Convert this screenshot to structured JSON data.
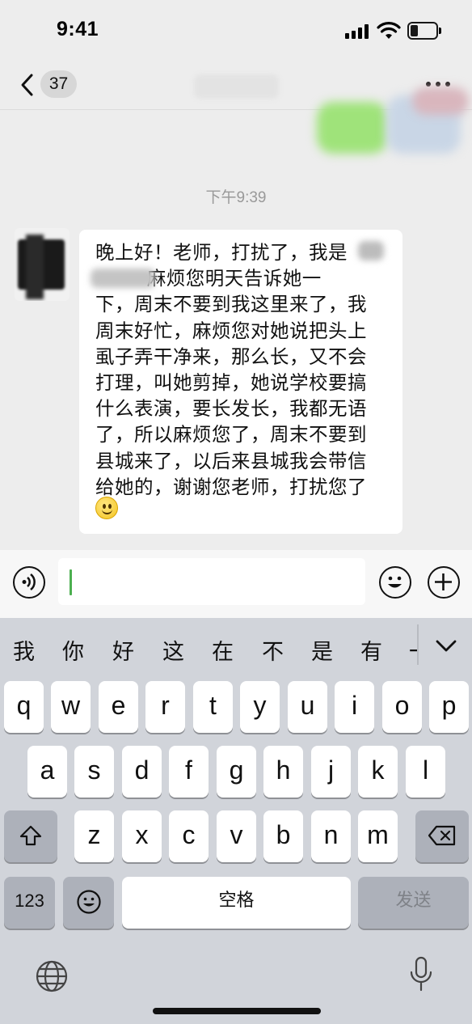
{
  "status_bar": {
    "time": "9:41"
  },
  "nav": {
    "unread_count": "37"
  },
  "chat": {
    "timestamp": "下午9:39",
    "message": {
      "lines": [
        "晚上好！老师，打扰了，我是",
        "        麻烦您明天告诉她一",
        "下，周末不要到我这里来了，我",
        "周末好忙，麻烦您对她说把头上",
        "虱子弄干净来，那么长，又不会",
        "打理，叫她剪掉，她说学校要搞",
        "什么表演，要长发长，我都无语",
        "了，所以麻烦您了，周末不要到",
        "县城来了，以后来县城我会带信",
        "给她的，谢谢您老师，打扰您了"
      ],
      "emoji": "smile-emoji"
    }
  },
  "input": {
    "value": ""
  },
  "keyboard": {
    "candidates": [
      "我",
      "你",
      "好",
      "这",
      "在",
      "不",
      "是",
      "有",
      "一"
    ],
    "row1": [
      "q",
      "w",
      "e",
      "r",
      "t",
      "y",
      "u",
      "i",
      "o",
      "p"
    ],
    "row2": [
      "a",
      "s",
      "d",
      "f",
      "g",
      "h",
      "j",
      "k",
      "l"
    ],
    "row3": [
      "z",
      "x",
      "c",
      "v",
      "b",
      "n",
      "m"
    ],
    "numbers_label": "123",
    "space_label": "空格",
    "send_label": "发送"
  },
  "colors": {
    "caret": "#4caf50",
    "bubble": "#ffffff",
    "background": "#ededed"
  }
}
